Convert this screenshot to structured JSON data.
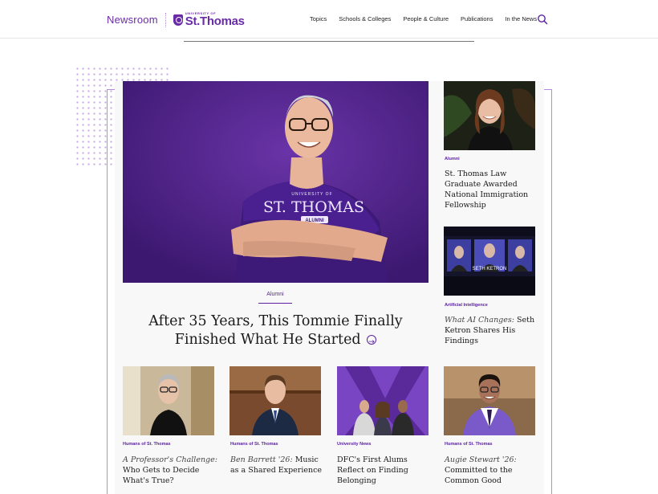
{
  "header": {
    "newsroom": "Newsroom",
    "logo_small": "UNIVERSITY OF",
    "logo_big": "St.Thomas",
    "nav": [
      "Topics",
      "Schools & Colleges",
      "People & Culture",
      "Publications",
      "In the News"
    ]
  },
  "colors": {
    "accent": "#5b23a0",
    "frame": "#b58be0",
    "panel": "#f8f8f8"
  },
  "hero": {
    "category": "Alumni",
    "title": "After 35 Years, This Tommie Finally Finished What He Started",
    "shirt_line1": "UNIVERSITY OF",
    "shirt_line2": "ST. THOMAS",
    "shirt_line3": "ALUMNI"
  },
  "side": [
    {
      "category": "Alumni",
      "title_plain": "St. Thomas Law Graduate Awarded National Immigration Fellowship"
    },
    {
      "category": "Artificial Intelligence",
      "title_italic": "What AI Changes:",
      "title_plain": "Seth Ketron Shares His Findings",
      "screen_caption": "SETH KETRON"
    }
  ],
  "bottom": [
    {
      "category": "Humans of St. Thomas",
      "title_italic": "A Professor's Challenge:",
      "title_plain": "Who Gets to Decide What's True?"
    },
    {
      "category": "Humans of St. Thomas",
      "title_italic": "Ben Barrett '26:",
      "title_plain": "Music as a Shared Experience"
    },
    {
      "category": "University News",
      "title_plain": "DFC's First Alums Reflect on Finding Belonging"
    },
    {
      "category": "Humans of St. Thomas",
      "title_italic": "Augie Stewart '26:",
      "title_plain": "Committed to the Common Good"
    }
  ]
}
